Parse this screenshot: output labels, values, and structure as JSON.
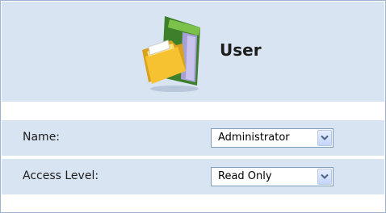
{
  "header": {
    "title": "User",
    "icon": "user-folder-icon"
  },
  "form": {
    "name": {
      "label": "Name:",
      "value": "Administrator"
    },
    "access_level": {
      "label": "Access Level:",
      "value": "Read Only"
    }
  },
  "colors": {
    "panel_bg": "#d8e4f2",
    "border": "#9fb3cf",
    "select_border": "#7f9db9",
    "arrow": "#4d6185"
  }
}
